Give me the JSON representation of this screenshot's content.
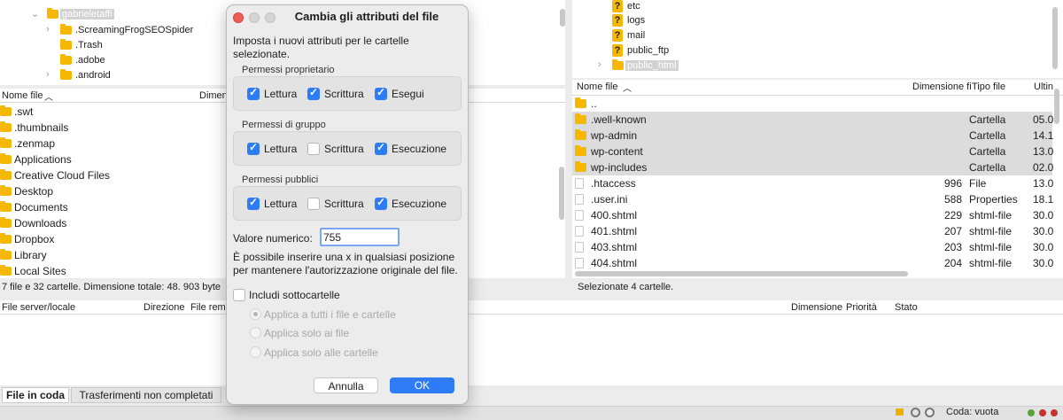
{
  "local_tree": {
    "root": "gabrieletaffi",
    "items": [
      ".ScreamingFrogSEOSpider",
      ".Trash",
      ".adobe",
      ".android"
    ]
  },
  "local_list": {
    "col_name": "Nome file",
    "col_size": "Dimen",
    "items": [
      ".swt",
      ".thumbnails",
      ".zenmap",
      "Applications",
      "Creative Cloud Files",
      "Desktop",
      "Documents",
      "Downloads",
      "Dropbox",
      "Library",
      "Local Sites"
    ],
    "status": "7 file e 32 cartelle. Dimensione totale: 48. 903 byte"
  },
  "remote_tree": {
    "items": [
      "etc",
      "logs",
      "mail",
      "public_ftp",
      "public_html"
    ]
  },
  "remote_list": {
    "col_name": "Nome file",
    "col_size": "Dimensione fi",
    "col_type": "Tipo file",
    "col_last": "Ultin",
    "parent": "..",
    "rows": [
      {
        "name": ".well-known",
        "size": "",
        "type": "Cartella",
        "date": "05.0",
        "folder": true,
        "selected": true
      },
      {
        "name": "wp-admin",
        "size": "",
        "type": "Cartella",
        "date": "14.1",
        "folder": true,
        "selected": true
      },
      {
        "name": "wp-content",
        "size": "",
        "type": "Cartella",
        "date": "13.0",
        "folder": true,
        "selected": true
      },
      {
        "name": "wp-includes",
        "size": "",
        "type": "Cartella",
        "date": "02.0",
        "folder": true,
        "selected": true
      },
      {
        "name": ".htaccess",
        "size": "996",
        "type": "File",
        "date": "13.0",
        "folder": false,
        "selected": false
      },
      {
        "name": ".user.ini",
        "size": "588",
        "type": "Properties",
        "date": "18.1",
        "folder": false,
        "selected": false
      },
      {
        "name": "400.shtml",
        "size": "229",
        "type": "shtml-file",
        "date": "30.0",
        "folder": false,
        "selected": false
      },
      {
        "name": "401.shtml",
        "size": "207",
        "type": "shtml-file",
        "date": "30.0",
        "folder": false,
        "selected": false
      },
      {
        "name": "403.shtml",
        "size": "203",
        "type": "shtml-file",
        "date": "30.0",
        "folder": false,
        "selected": false
      },
      {
        "name": "404.shtml",
        "size": "204",
        "type": "shtml-file",
        "date": "30.0",
        "folder": false,
        "selected": false
      }
    ],
    "status": "Selezionate 4 cartelle."
  },
  "queue": {
    "col_file": "File server/locale",
    "col_direction": "Direzione",
    "col_remote": "File remo",
    "col_size": "Dimensione",
    "col_priority": "Priorità",
    "col_state": "Stato",
    "tab_queue": "File in coda",
    "tab_failed": "Trasferimenti non completati",
    "status": "Coda: vuota"
  },
  "dialog": {
    "title": "Cambia gli attributi del file",
    "intro": "Imposta i nuovi attributi per le cartelle selezionate.",
    "owner": {
      "label": "Permessi proprietario",
      "read": "Lettura",
      "write": "Scrittura",
      "exec": "Esegui"
    },
    "group": {
      "label": "Permessi di gruppo",
      "read": "Lettura",
      "write": "Scrittura",
      "exec": "Esecuzione"
    },
    "public": {
      "label": "Permessi pubblici",
      "read": "Lettura",
      "write": "Scrittura",
      "exec": "Esecuzione"
    },
    "numeric_label": "Valore numerico:",
    "numeric_value": "755",
    "hint": "È possibile inserire una x in qualsiasi posizione per mantenere l'autorizzazione originale del file.",
    "include_sub": "Includi sottocartelle",
    "apply_all": "Applica a tutti i file e cartelle",
    "apply_files": "Applica solo ai file",
    "apply_dirs": "Applica solo alle cartelle",
    "cancel": "Annulla",
    "ok": "OK"
  },
  "colors": {
    "accent": "#2e7bf6",
    "folder": "#f5b700",
    "selection": "#dcdcdc"
  },
  "icons": [
    "folder-icon",
    "file-icon",
    "unknown-folder-icon",
    "lock-icon",
    "gear-icon",
    "status-lights"
  ]
}
